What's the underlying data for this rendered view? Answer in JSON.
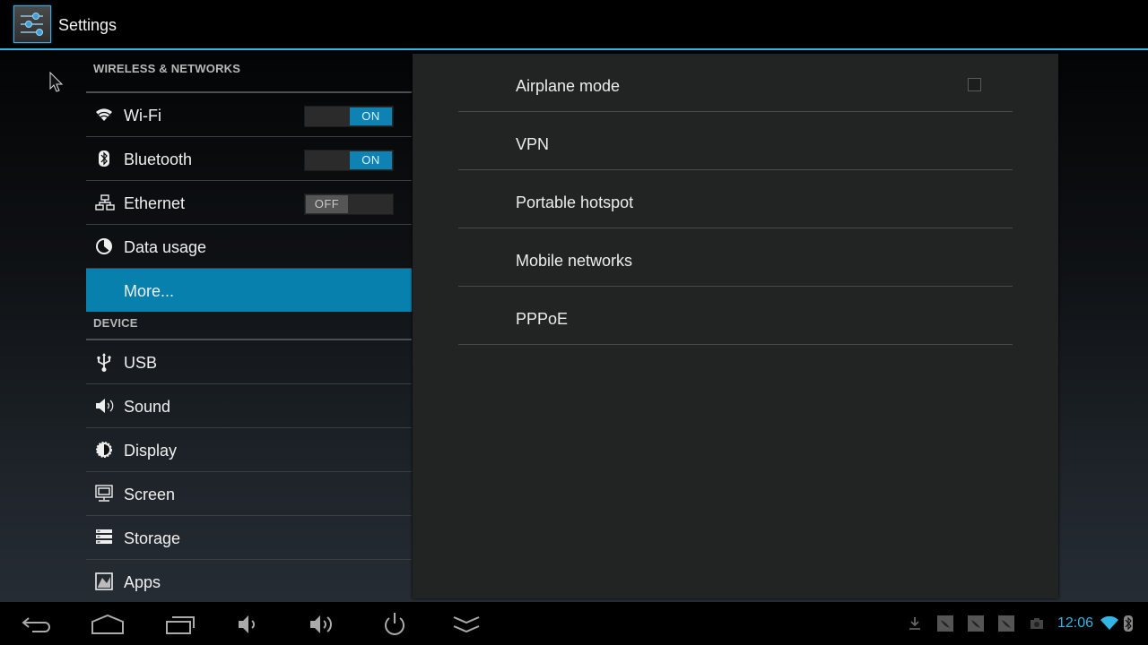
{
  "app": {
    "title": "Settings",
    "icon": "settings-sliders-icon"
  },
  "colors": {
    "accent": "#33b5e5",
    "selected": "#0780ad",
    "toggle_on": "#0e83b3",
    "toggle_off": "#555555"
  },
  "sidebar": {
    "categories": [
      {
        "label": "WIRELESS & NETWORKS",
        "items": [
          {
            "label": "Wi-Fi",
            "icon": "wifi-icon",
            "toggle": "ON"
          },
          {
            "label": "Bluetooth",
            "icon": "bluetooth-icon",
            "toggle": "ON"
          },
          {
            "label": "Ethernet",
            "icon": "ethernet-icon",
            "toggle": "OFF"
          },
          {
            "label": "Data usage",
            "icon": "data-usage-icon"
          },
          {
            "label": "More...",
            "icon": "",
            "selected": true
          }
        ]
      },
      {
        "label": "DEVICE",
        "items": [
          {
            "label": "USB",
            "icon": "usb-icon"
          },
          {
            "label": "Sound",
            "icon": "sound-icon"
          },
          {
            "label": "Display",
            "icon": "display-icon"
          },
          {
            "label": "Screen",
            "icon": "screen-icon"
          },
          {
            "label": "Storage",
            "icon": "storage-icon"
          },
          {
            "label": "Apps",
            "icon": "apps-icon"
          }
        ]
      }
    ]
  },
  "content": {
    "items": [
      {
        "label": "Airplane mode",
        "checkbox": false
      },
      {
        "label": "VPN"
      },
      {
        "label": "Portable hotspot"
      },
      {
        "label": "Mobile networks"
      },
      {
        "label": "PPPoE"
      }
    ]
  },
  "navbar": {
    "buttons": [
      "back",
      "home",
      "recent-apps",
      "volume-down",
      "volume-up",
      "power",
      "hide-bar"
    ]
  },
  "status_bar": {
    "notifications": [
      "download-icon",
      "notification-icon",
      "notification-icon",
      "notification-icon",
      "screenshot-icon"
    ],
    "time": "12:06",
    "wifi": "connected",
    "bluetooth": "on"
  }
}
